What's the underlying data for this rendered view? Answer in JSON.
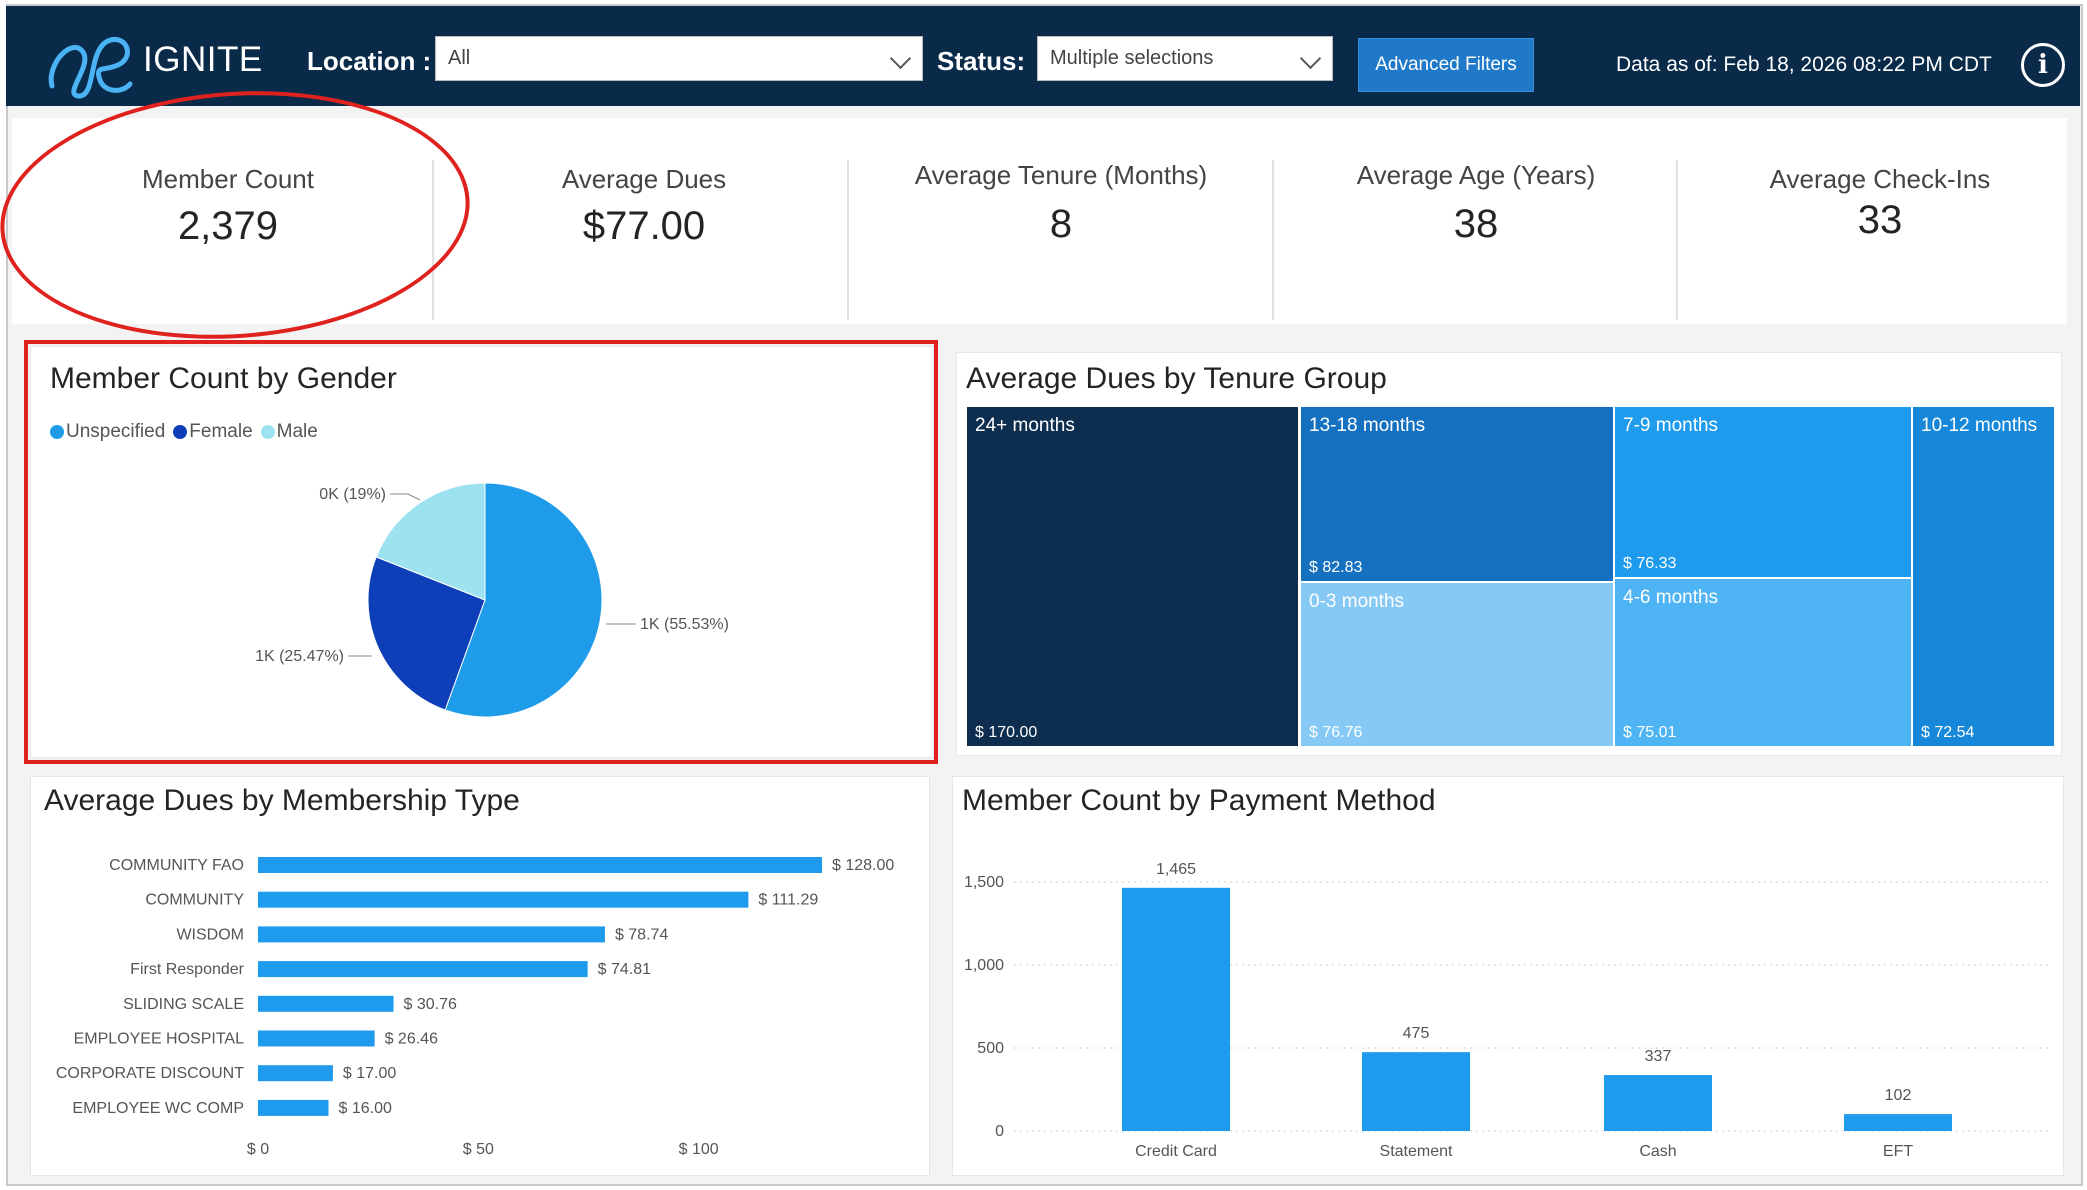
{
  "header": {
    "brand": "IGNITE",
    "location_label": "Location :",
    "location_value": "All",
    "status_label": "Status:",
    "status_value": "Multiple selections",
    "advanced_filters": "Advanced Filters",
    "data_as_of": "Data as of: Feb 18, 2026  08:22 PM CDT",
    "info_glyph": "i"
  },
  "kpis": [
    {
      "title": "Member Count",
      "value": "2,379"
    },
    {
      "title": "Average Dues",
      "value": "$77.00"
    },
    {
      "title": "Average Tenure (Months)",
      "value": "8"
    },
    {
      "title": "Average Age (Years)",
      "value": "38"
    },
    {
      "title": "Average Check-Ins",
      "value": "33"
    }
  ],
  "gender": {
    "title": "Member Count by Gender",
    "legend": [
      "Unspecified",
      "Female",
      "Male"
    ],
    "labels": {
      "male": "0K (19%)",
      "female": "1K (25.47%)",
      "unspecified": "1K (55.53%)"
    }
  },
  "tenure": {
    "title": "Average Dues by Tenure Group",
    "cells": [
      {
        "label": "24+ months",
        "value": "$ 170.00"
      },
      {
        "label": "13-18 months",
        "value": "$ 82.83"
      },
      {
        "label": "0-3 months",
        "value": "$ 76.76"
      },
      {
        "label": "7-9 months",
        "value": "$ 76.33"
      },
      {
        "label": "4-6 months",
        "value": "$ 75.01"
      },
      {
        "label": "10-12 months",
        "value": "$ 72.54"
      }
    ]
  },
  "membership": {
    "title": "Average Dues by Membership Type",
    "labels": [
      "$ 128.00",
      "$ 111.29",
      "$ 78.74",
      "$ 74.81",
      "$ 30.76",
      "$ 26.46",
      "$ 17.00",
      "$ 16.00"
    ],
    "ticks": [
      "$ 0",
      "$ 50",
      "$ 100"
    ]
  },
  "payment": {
    "title": "Member Count by Payment Method",
    "labels": [
      "1,465",
      "475",
      "337",
      "102"
    ],
    "ticks": [
      "0",
      "500",
      "1,000",
      "1,500"
    ]
  },
  "colors": {
    "header": "#0a2a4a",
    "accent": "#1f9bee",
    "annotation_red": "#e0221e",
    "unspecified": "#1e9be9",
    "female": "#0f3fb8",
    "male": "#9de3ef"
  },
  "chart_data": [
    {
      "type": "pie",
      "title": "Member Count by Gender",
      "categories": [
        "Unspecified",
        "Female",
        "Male"
      ],
      "values": [
        55.53,
        25.47,
        19.0
      ]
    },
    {
      "type": "heatmap",
      "title": "Average Dues by Tenure Group",
      "categories": [
        "24+ months",
        "13-18 months",
        "0-3 months",
        "7-9 months",
        "4-6 months",
        "10-12 months"
      ],
      "values": [
        170.0,
        82.83,
        76.76,
        76.33,
        75.01,
        72.54
      ]
    },
    {
      "type": "bar",
      "title": "Average Dues by Membership Type",
      "categories": [
        "COMMUNITY FAO",
        "COMMUNITY",
        "WISDOM",
        "First Responder",
        "SLIDING SCALE",
        "EMPLOYEE HOSPITAL",
        "CORPORATE DISCOUNT",
        "EMPLOYEE WC COMP"
      ],
      "values": [
        128.0,
        111.29,
        78.74,
        74.81,
        30.76,
        26.46,
        17.0,
        16.0
      ],
      "xlim": [
        0,
        135
      ]
    },
    {
      "type": "bar",
      "title": "Member Count by Payment Method",
      "categories": [
        "Credit Card",
        "Statement",
        "Cash",
        "EFT"
      ],
      "values": [
        1465,
        475,
        337,
        102
      ],
      "ylim": [
        0,
        1550
      ],
      "grid": true
    }
  ]
}
